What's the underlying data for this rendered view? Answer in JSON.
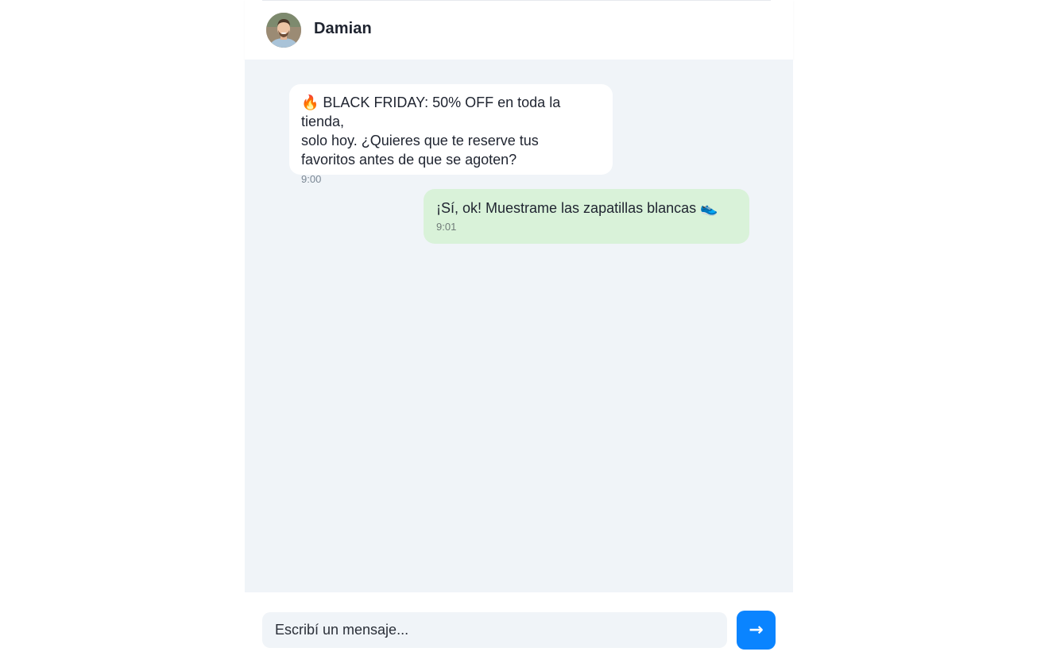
{
  "header": {
    "contact_name": "Damian",
    "avatar_icon": "contact-photo"
  },
  "messages": [
    {
      "direction": "incoming",
      "text": "🔥 BLACK FRIDAY: 50% OFF en toda la tienda,\nsolo hoy. ¿Quieres que te reserve tus\nfavoritos antes de que se agoten?",
      "time": "9:00"
    },
    {
      "direction": "outgoing",
      "text": "¡Sí, ok! Muestrame las zapatillas blancas 👟",
      "time": "9:01"
    }
  ],
  "composer": {
    "placeholder": "Escribí un mensaje...",
    "value": "",
    "send_icon": "→"
  },
  "colors": {
    "chat_background": "#f0f4f8",
    "incoming_bubble": "#ffffff",
    "outgoing_bubble": "#d9f2d9",
    "accent": "#0a84ff"
  }
}
